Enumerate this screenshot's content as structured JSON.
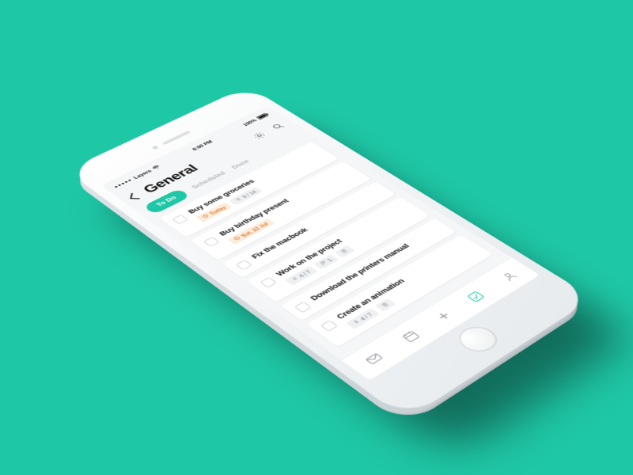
{
  "statusbar": {
    "carrier": "Layers",
    "time": "6:00 PM",
    "battery": "100%"
  },
  "header": {
    "title": "General"
  },
  "tabs": [
    {
      "label": "To Do",
      "active": true
    },
    {
      "label": "Scheduled",
      "active": false
    },
    {
      "label": "Done",
      "active": false
    }
  ],
  "tasks": [
    {
      "title": "Buy some groceries",
      "badges": [
        {
          "kind": "orange",
          "icon": "clock",
          "text": "Today"
        },
        {
          "kind": "grey",
          "icon": "list",
          "text": "9 / 14"
        }
      ]
    },
    {
      "title": "Buy birthday present",
      "badges": [
        {
          "kind": "orange",
          "icon": "clock",
          "text": "Sat, 22 Jul"
        }
      ]
    },
    {
      "title": "Fix the macbook",
      "badges": []
    },
    {
      "title": "Work on the project",
      "badges": [
        {
          "kind": "grey",
          "icon": "list",
          "text": "4 / 7"
        },
        {
          "kind": "grey",
          "icon": "attach",
          "text": "1"
        },
        {
          "kind": "grey",
          "icon": "doc",
          "text": ""
        }
      ]
    },
    {
      "title": "Download the printers manual",
      "badges": []
    },
    {
      "title": "Create an animation",
      "badges": [
        {
          "kind": "grey",
          "icon": "list",
          "text": "4 / 7"
        },
        {
          "kind": "grey",
          "icon": "doc",
          "text": ""
        }
      ]
    }
  ],
  "icons": {
    "list": "≡",
    "attach": "📎",
    "doc": "🗒"
  }
}
